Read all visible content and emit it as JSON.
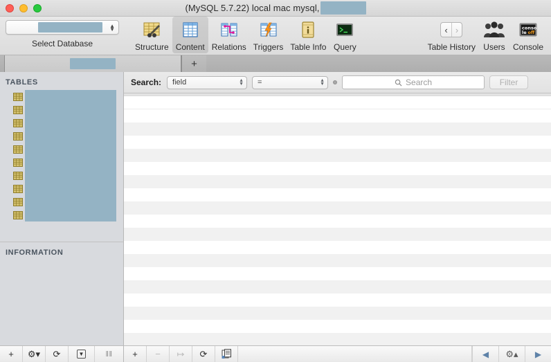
{
  "window": {
    "title_prefix": "(MySQL 5.7.22) local mac mysql,",
    "traffic_lights": [
      "close",
      "minimize",
      "maximize"
    ],
    "redaction_color": "#94b3c4"
  },
  "toolbar": {
    "database_selector": {
      "label": "Select Database",
      "value": "",
      "redacted": true
    },
    "items": [
      {
        "id": "structure",
        "label": "Structure",
        "icon": "table-structure-icon",
        "selected": false
      },
      {
        "id": "content",
        "label": "Content",
        "icon": "table-content-icon",
        "selected": true
      },
      {
        "id": "relations",
        "label": "Relations",
        "icon": "table-relations-icon",
        "selected": false
      },
      {
        "id": "triggers",
        "label": "Triggers",
        "icon": "table-triggers-icon",
        "selected": false
      },
      {
        "id": "table-info",
        "label": "Table Info",
        "icon": "info-icon",
        "selected": false
      },
      {
        "id": "query",
        "label": "Query",
        "icon": "terminal-icon",
        "selected": false
      }
    ],
    "right_items": [
      {
        "id": "table-history",
        "label": "Table History",
        "icon": "back-forward-icon"
      },
      {
        "id": "users",
        "label": "Users",
        "icon": "users-icon"
      },
      {
        "id": "console",
        "label": "Console",
        "icon": "console-icon",
        "icon_text_line1": "conso",
        "icon_text_line2": "le",
        "icon_text_badge": "off"
      }
    ],
    "history_back": "‹",
    "history_forward": "›"
  },
  "tabbar": {
    "active_tab_label": "",
    "active_tab_redacted": true,
    "new_tab_label": "+"
  },
  "sidebar": {
    "tables_header": "TABLES",
    "information_header": "INFORMATION",
    "tables": [
      {
        "name": "",
        "redacted": true
      },
      {
        "name": "",
        "redacted": true
      },
      {
        "name": "",
        "redacted": true
      },
      {
        "name": "",
        "redacted": true
      },
      {
        "name": "",
        "redacted": true
      },
      {
        "name": "",
        "redacted": true
      },
      {
        "name": "",
        "redacted": true
      },
      {
        "name": "",
        "redacted": true
      },
      {
        "name": "",
        "redacted": true
      },
      {
        "name": "",
        "redacted": true
      }
    ],
    "footer_buttons": [
      {
        "id": "add-table",
        "label": "+",
        "icon": "plus-icon"
      },
      {
        "id": "table-actions",
        "label": "⚙▾",
        "icon": "gear-dropdown-icon"
      },
      {
        "id": "refresh-tables",
        "label": "⟳",
        "icon": "refresh-icon"
      },
      {
        "id": "filter-tables",
        "label": "▼",
        "icon": "filter-box-icon"
      }
    ],
    "resize_grip": "‖‖"
  },
  "search": {
    "label": "Search:",
    "field_select_value": "field",
    "operator_select_value": "=",
    "input_value": "",
    "input_placeholder": "Search",
    "search_icon": "magnifier-icon",
    "filter_button_label": "Filter",
    "indicator": "status-dot-icon"
  },
  "grid": {
    "rows": 20,
    "columns": [],
    "cells": [],
    "empty": true
  },
  "main_footer": {
    "buttons": [
      {
        "id": "add-row",
        "label": "+",
        "icon": "plus-icon",
        "disabled": false
      },
      {
        "id": "remove-row",
        "label": "−",
        "icon": "minus-icon",
        "disabled": true
      },
      {
        "id": "duplicate-row",
        "label": "↦",
        "icon": "duplicate-icon",
        "disabled": true
      },
      {
        "id": "refresh-rows",
        "label": "⟳",
        "icon": "refresh-icon",
        "disabled": false
      },
      {
        "id": "copy-rows",
        "label": "❐",
        "icon": "copy-icon",
        "disabled": false
      }
    ],
    "nav": [
      {
        "id": "prev-page",
        "label": "◀",
        "icon": "arrow-left-icon"
      },
      {
        "id": "page-options",
        "label": "⚙▴",
        "icon": "gear-up-icon"
      },
      {
        "id": "next-page",
        "label": "▶",
        "icon": "arrow-right-icon"
      }
    ]
  }
}
